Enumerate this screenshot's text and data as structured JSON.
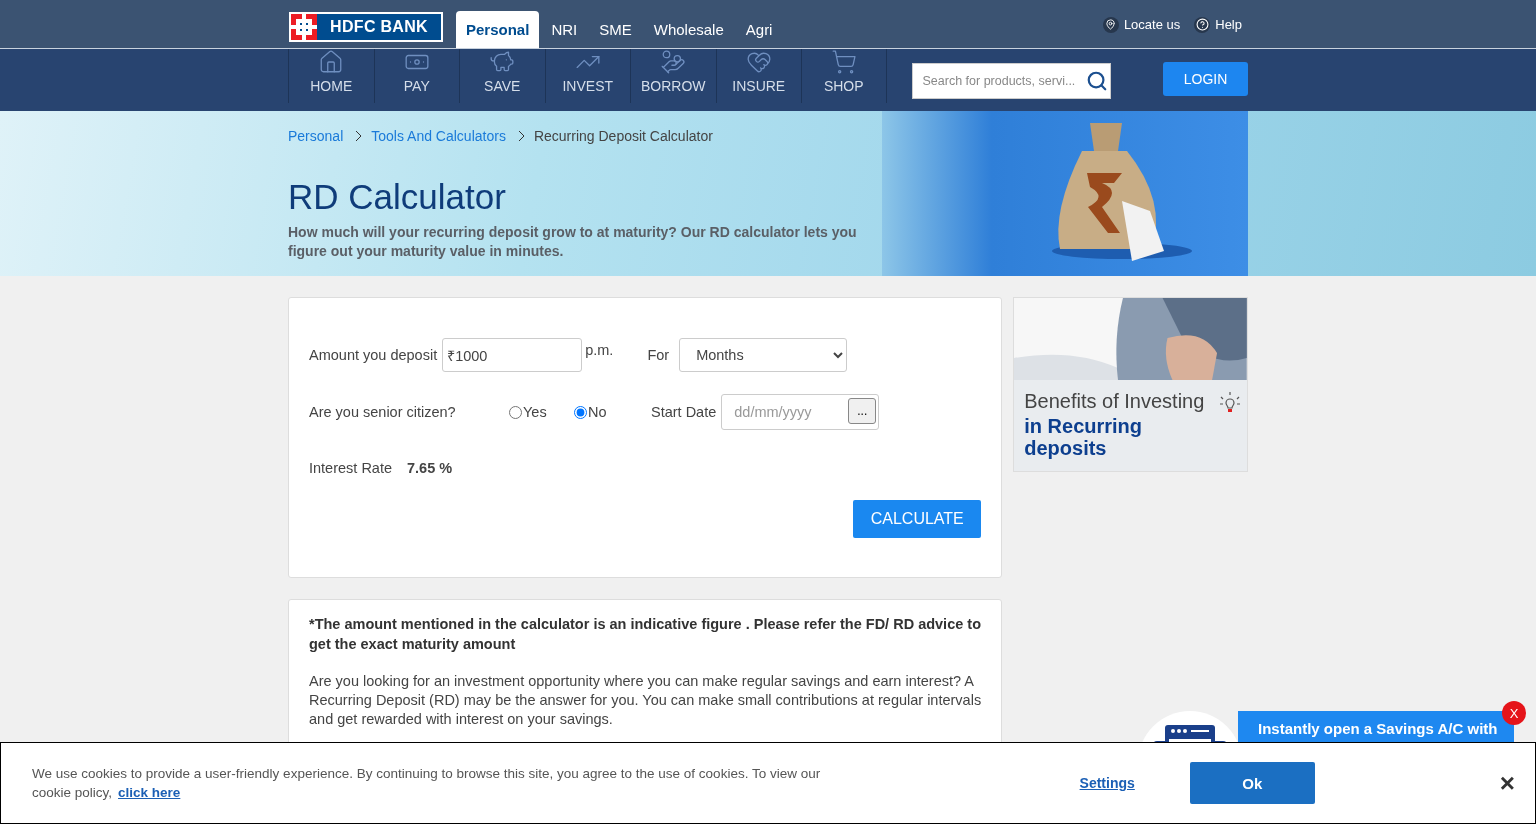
{
  "logo": {
    "text": "HDFC BANK"
  },
  "top_tabs": [
    {
      "label": "Personal",
      "selected": true
    },
    {
      "label": "NRI",
      "selected": false
    },
    {
      "label": "SME",
      "selected": false
    },
    {
      "label": "Wholesale",
      "selected": false
    },
    {
      "label": "Agri",
      "selected": false
    }
  ],
  "utility_links": [
    {
      "label": "Locate us",
      "kind": "pin"
    },
    {
      "label": "Help",
      "kind": "help"
    }
  ],
  "nav": [
    {
      "label": "HOME",
      "kind": "home"
    },
    {
      "label": "PAY",
      "kind": "pay"
    },
    {
      "label": "SAVE",
      "kind": "save"
    },
    {
      "label": "INVEST",
      "kind": "invest"
    },
    {
      "label": "BORROW",
      "kind": "borrow"
    },
    {
      "label": "INSURE",
      "kind": "insure"
    },
    {
      "label": "SHOP",
      "kind": "shop"
    }
  ],
  "search": {
    "placeholder": "Search for products, servi..."
  },
  "login_button": "LOGIN",
  "breadcrumb": [
    {
      "label": "Personal",
      "link": true
    },
    {
      "label": "Tools And Calculators",
      "link": true
    },
    {
      "label": "Recurring Deposit Calculator",
      "link": false
    }
  ],
  "hero": {
    "title": "RD Calculator",
    "subtitle": "How much will your recurring deposit grow to at maturity? Our RD calculator lets you figure out your maturity value in minutes."
  },
  "calculator": {
    "amount_label": "Amount you deposit",
    "amount_value": "₹1000",
    "amount_unit": "p.m.",
    "for_label": "For",
    "period_value": "Months",
    "senior_label": "Are you senior citizen?",
    "senior_options": [
      {
        "label": "Yes",
        "selected": false
      },
      {
        "label": "No",
        "selected": true
      }
    ],
    "start_date": {
      "label": "Start Date",
      "placeholder": "dd/mm/yyyy",
      "button": "..."
    },
    "rate_label": "Interest Rate",
    "rate_value": "7.65 %",
    "calculate_button": "CALCULATE"
  },
  "side_banner": {
    "line1": "Benefits of Investing",
    "line2": "in Recurring deposits"
  },
  "disclaimer": {
    "note": "*The amount mentioned in the calculator is an indicative figure . Please refer the FD/ RD advice to get the exact maturity amount",
    "body": "Are you looking for an investment opportunity where you can make regular savings and earn interest? A Recurring Deposit (RD) may be the answer for you. You can make small contributions at regular intervals and get rewarded with interest on your savings."
  },
  "promo": {
    "text": "Instantly open a Savings A/C with",
    "close": "X"
  },
  "cookie": {
    "text": "We use cookies to provide a user-friendly experience. By continuing to browse this site, you agree to the use of cookies. To view our cookie policy,",
    "link": "click here",
    "settings": "Settings",
    "ok": "Ok",
    "close": "×"
  }
}
